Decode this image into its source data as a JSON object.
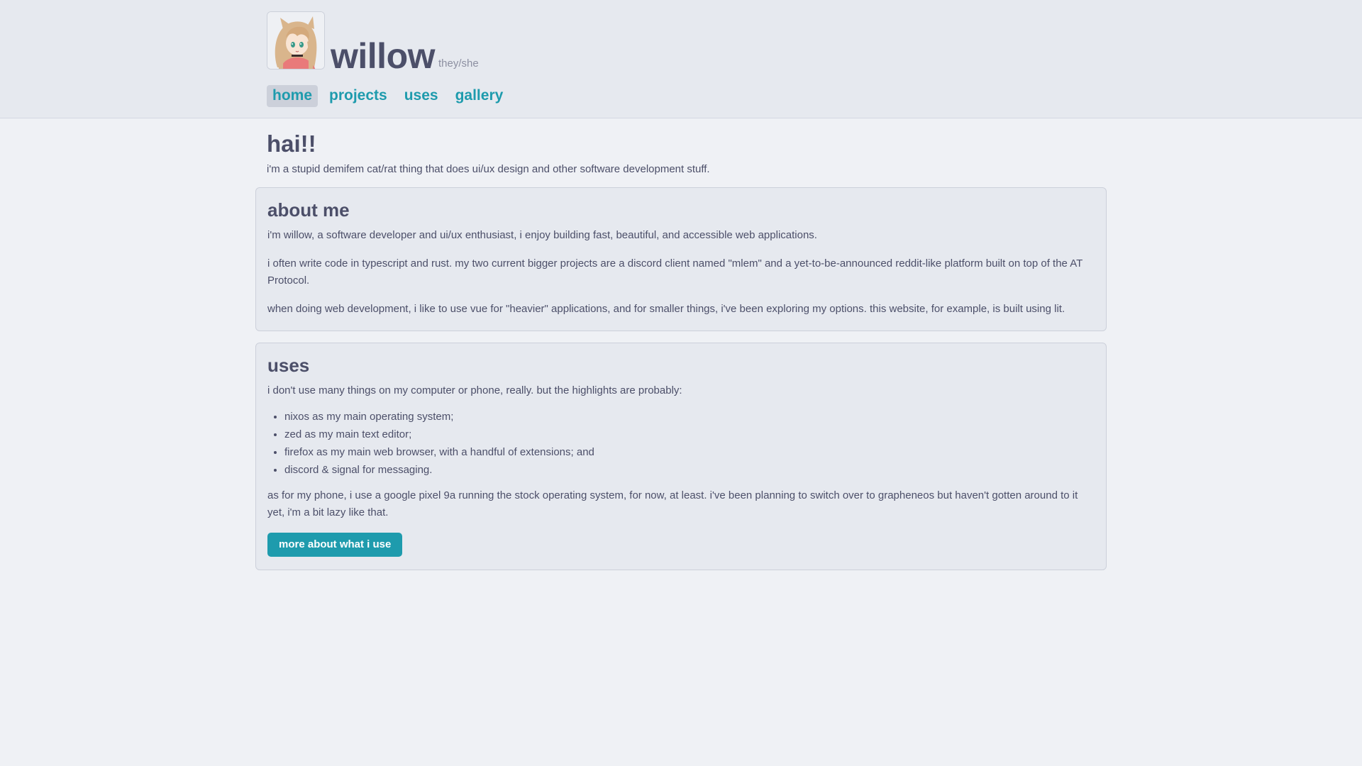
{
  "site": {
    "title": "willow",
    "pronouns": "they/she"
  },
  "nav": {
    "items": [
      {
        "label": "home",
        "active": true
      },
      {
        "label": "projects",
        "active": false
      },
      {
        "label": "uses",
        "active": false
      },
      {
        "label": "gallery",
        "active": false
      }
    ]
  },
  "hero": {
    "title": "hai!!",
    "subtitle": "i'm a stupid demifem cat/rat thing that does ui/ux design and other software development stuff."
  },
  "about": {
    "heading": "about me",
    "paragraphs": [
      "i'm willow, a software developer and ui/ux enthusiast, i enjoy building fast, beautiful, and accessible web applications.",
      "i often write code in typescript and rust. my two current bigger projects are a discord client named \"mlem\" and a yet-to-be-announced reddit-like platform built on top of the AT Protocol.",
      "when doing web development, i like to use vue for \"heavier\" applications, and for smaller things, i've been exploring my options. this website, for example, is built using lit."
    ]
  },
  "uses": {
    "heading": "uses",
    "intro": "i don't use many things on my computer or phone, really. but the highlights are probably:",
    "list": [
      "nixos as my main operating system;",
      "zed as my main text editor;",
      "firefox as my main web browser, with a handful of extensions; and",
      "discord & signal for messaging."
    ],
    "phone_paragraph": "as for my phone, i use a google pixel 9a running the stock operating system, for now, at least. i've been planning to switch over to grapheneos but haven't gotten around to it yet, i'm a bit lazy like that.",
    "button_label": "more about what i use"
  },
  "colors": {
    "accent": "#1e9bad",
    "text": "#4c4f69",
    "muted": "#8c8fa1",
    "page_bg": "#eff1f5",
    "card_bg": "#e6e9ef",
    "border": "#ccd0da"
  },
  "icons": {
    "avatar": "avatar-image"
  }
}
